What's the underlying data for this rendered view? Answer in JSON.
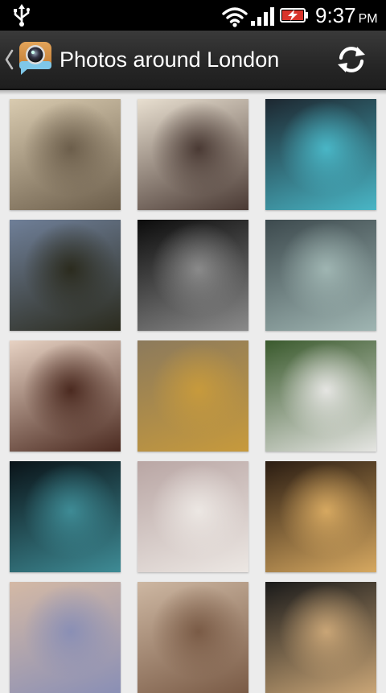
{
  "status_bar": {
    "time": "9:37",
    "ampm": "PM",
    "icons": [
      "usb-icon",
      "wifi-icon",
      "signal-icon",
      "battery-charging-icon"
    ]
  },
  "action_bar": {
    "title": "Photos around London",
    "up_icon": "chevron-left-icon",
    "app_icon": "camera-app-icon",
    "action_icon": "refresh-icon"
  },
  "photos": [
    {
      "name": "photo-london-skyline",
      "colors": [
        "#d9cbb0",
        "#6c5e4b"
      ]
    },
    {
      "name": "photo-man-beanie-selfie",
      "colors": [
        "#e8dfd0",
        "#4a3a34"
      ]
    },
    {
      "name": "photo-neon-sign",
      "colors": [
        "#1d2730",
        "#49b6c6"
      ]
    },
    {
      "name": "photo-ornate-lamp-post",
      "colors": [
        "#6f7f98",
        "#2b2b1e"
      ]
    },
    {
      "name": "photo-london-eye-night",
      "colors": [
        "#0c0c0c",
        "#8a8a8a"
      ]
    },
    {
      "name": "photo-queen-with-corgis",
      "colors": [
        "#3d4a4e",
        "#9fb5b2"
      ]
    },
    {
      "name": "photo-chocolate-donut",
      "colors": [
        "#e7d2c3",
        "#4b2a20"
      ]
    },
    {
      "name": "photo-egyptian-cat-sarcophagus",
      "colors": [
        "#8c7a5c",
        "#c79a3c"
      ]
    },
    {
      "name": "photo-woman-in-park",
      "colors": [
        "#3a5a2d",
        "#e5e5e2"
      ]
    },
    {
      "name": "photo-screen-waiting",
      "colors": [
        "#0a1318",
        "#3e8b95"
      ]
    },
    {
      "name": "photo-mustache-sweater",
      "colors": [
        "#b9a6a4",
        "#ece7e3"
      ]
    },
    {
      "name": "photo-two-blondes-selfie",
      "colors": [
        "#2a1c12",
        "#d6a860"
      ]
    },
    {
      "name": "photo-back-tattoo",
      "colors": [
        "#d4b9a5",
        "#8a8fb5"
      ]
    },
    {
      "name": "photo-coffee-cup-name",
      "colors": [
        "#cdb7a2",
        "#7a5b46"
      ]
    },
    {
      "name": "photo-plate-of-food",
      "colors": [
        "#1a1a1a",
        "#c9a576"
      ]
    }
  ]
}
